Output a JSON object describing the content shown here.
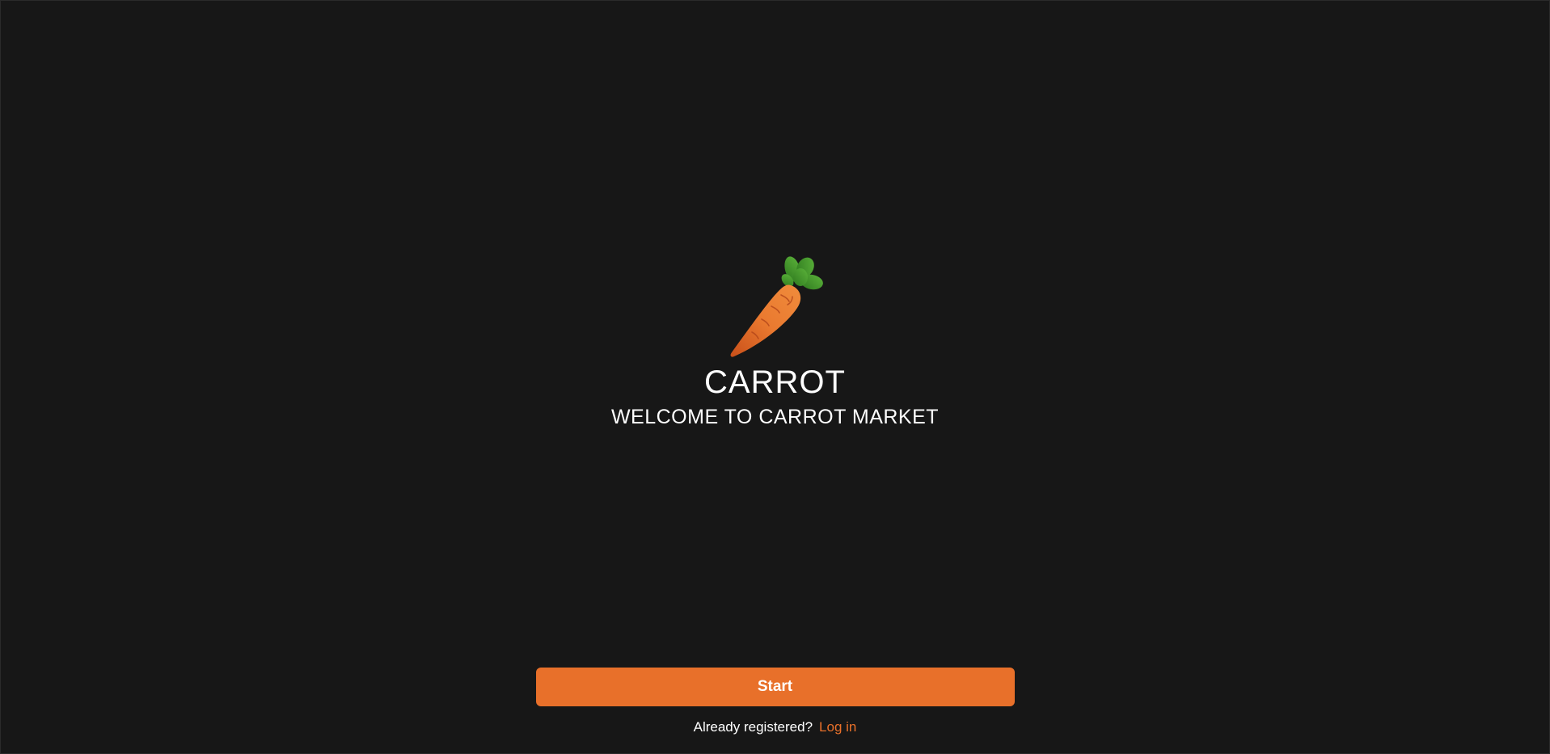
{
  "brand": {
    "logo_icon": "carrot-icon",
    "title": "CARROT",
    "subtitle": "WELCOME TO CARROT MARKET"
  },
  "actions": {
    "start_label": "Start",
    "already_registered_text": "Already registered?",
    "login_label": "Log in"
  },
  "colors": {
    "background": "#171717",
    "accent": "#e8702a",
    "text": "#ffffff"
  }
}
